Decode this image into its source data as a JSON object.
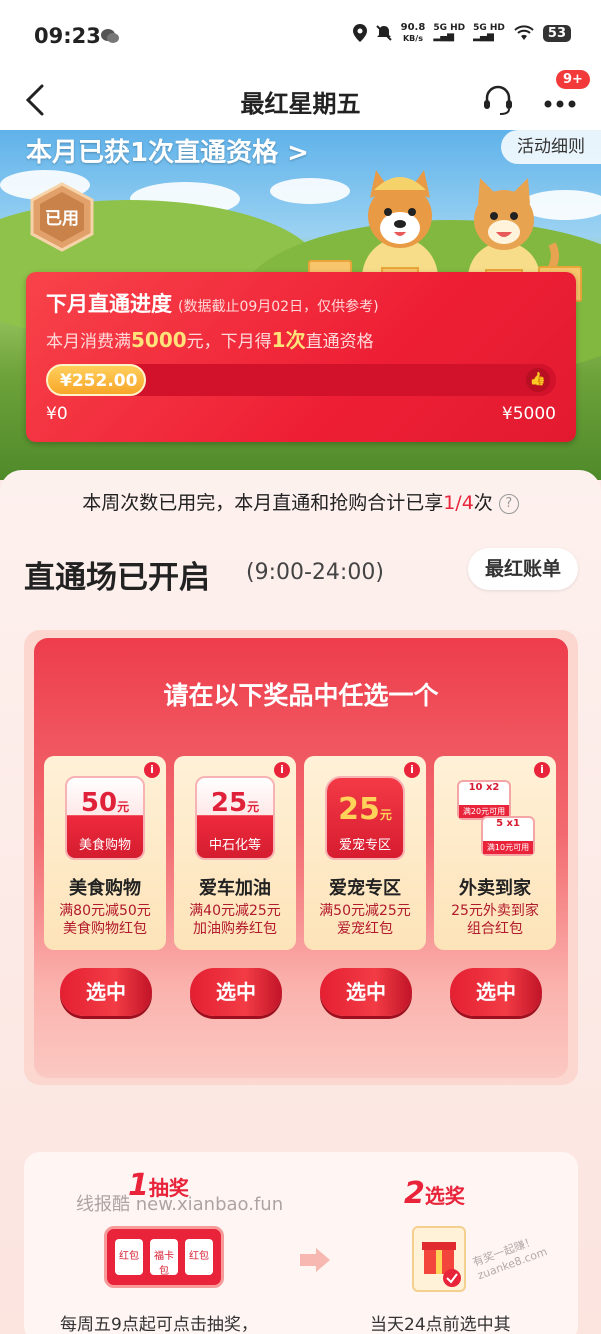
{
  "status_bar": {
    "time": "09:23",
    "speed_value": "90.8",
    "speed_unit": "KB/s",
    "signal1": "5G HD",
    "signal2": "5G HD",
    "battery": "53"
  },
  "nav": {
    "title": "最红星期五",
    "badge": "9+"
  },
  "hero": {
    "title": "本月已获1次直通资格 >",
    "rules_button": "活动细则",
    "used_badge": "已用"
  },
  "progress": {
    "title": "下月直通进度",
    "note": "(数据截止09月02日，仅供参考)",
    "rule_prefix": "本月消费满",
    "rule_amount": "5000",
    "rule_mid": "元，下月得",
    "rule_count": "1次",
    "rule_suffix": "直通资格",
    "current_value": "¥252.00",
    "fraction": 0.0504,
    "min_label": "¥0",
    "max_label": "¥5000"
  },
  "week_note": {
    "text": "本周次数已用完，本月直通和抢购合计已享",
    "highlight": "1/4",
    "suffix": "次",
    "help_icon": "?"
  },
  "zone": {
    "title": "直通场已开启",
    "time": "(9:00-24:00)",
    "bill_button": "最红账单"
  },
  "prize_panel": {
    "heading": "请在以下奖品中任选一个",
    "info_icon": "i",
    "prizes": [
      {
        "amount": "50",
        "unit": "元",
        "tag": "美食购物",
        "name": "美食购物",
        "desc1": "满80元减50元",
        "desc2": "美食购物红包",
        "button": "选中"
      },
      {
        "amount": "25",
        "unit": "元",
        "tag": "中石化等",
        "name": "爱车加油",
        "desc1": "满40元减25元",
        "desc2": "加油购券红包",
        "button": "选中"
      },
      {
        "amount": "25",
        "unit": "元",
        "tag": "爱宠专区",
        "name": "爱宠专区",
        "desc1": "满50元减25元",
        "desc2": "爱宠红包",
        "button": "选中"
      },
      {
        "coupon_a": "10",
        "coupon_a_count": "x2",
        "coupon_a_tag": "满20元可用",
        "coupon_b": "5",
        "coupon_b_count": "x1",
        "coupon_b_tag": "满10元可用",
        "name": "外卖到家",
        "desc1": "25元外卖到家",
        "desc2": "组合红包",
        "button": "选中"
      }
    ]
  },
  "steps": {
    "step1_num": "1",
    "step1_label": "抽奖",
    "step2_num": "2",
    "step2_label": "选奖",
    "watermark": "线报酷 new.xianbao.fun",
    "watermark2": "有奖一起赚！ zuanke8.com",
    "slot_labels": [
      "红包",
      "福卡包",
      "红包"
    ],
    "step1_desc": "每周五9点起可点击抽奖，",
    "step2_desc": "当天24点前选中其"
  }
}
